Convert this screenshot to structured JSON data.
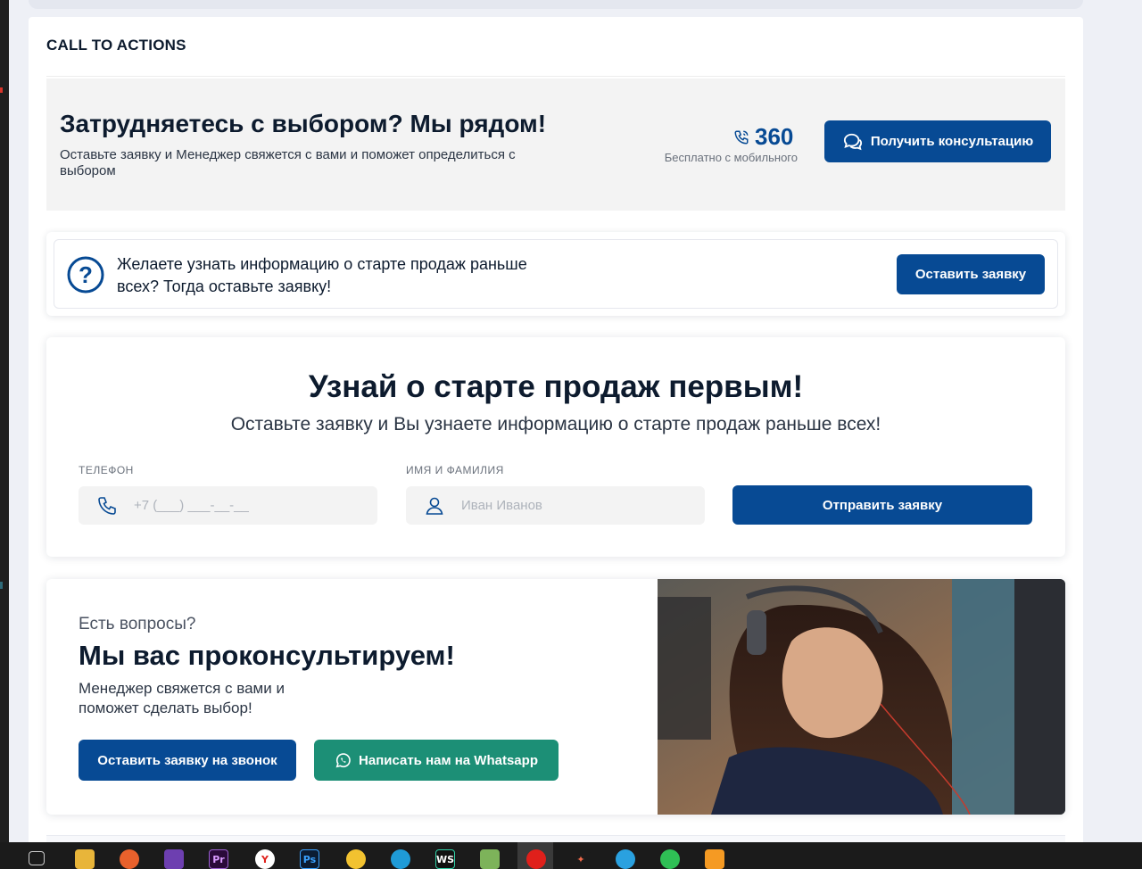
{
  "panel": {
    "title": "CALL TO ACTIONS"
  },
  "cta1": {
    "title": "Затрудняетесь с выбором? Мы рядом!",
    "text": "Оставьте заявку и Менеджер свяжется с вами и поможет определиться с выбором",
    "phone": "360",
    "phone_note": "Бесплатно с мобильного",
    "button": "Получить консультацию"
  },
  "cta2": {
    "text": "Желаете узнать информацию о старте продаж раньше всех? Тогда оставьте заявку!",
    "button": "Оставить заявку"
  },
  "cta3": {
    "title": "Узнай о старте продаж первым!",
    "subtitle": "Оставьте заявку и Вы узнаете информацию о старте продаж раньше всех!",
    "phone_label": "ТЕЛЕФОН",
    "phone_placeholder": "+7 (___) ___-__-__",
    "name_label": "ИМЯ И ФАМИЛИЯ",
    "name_placeholder": "Иван Иванов",
    "button": "Отправить заявку"
  },
  "cta4": {
    "pre": "Есть вопросы?",
    "title": "Мы вас проконсультируем!",
    "text": "Менеджер свяжется с вами и поможет сделать выбор!",
    "call_button": "Оставить заявку на звонок",
    "whatsapp_button": "Написать нам на Whatsapp"
  },
  "colors": {
    "primary": "#074a94",
    "whatsapp": "#1c8f76",
    "muted_bg": "#f3f3f3"
  },
  "taskbar": {
    "icons": [
      "windows-explorer-icon",
      "file-explorer-icon",
      "firefox-icon",
      "visual-studio-icon",
      "premiere-icon",
      "yandex-icon",
      "photoshop-icon",
      "chrome-icon",
      "edge-icon",
      "webstorm-icon",
      "app-icon",
      "opera-icon",
      "figma-icon",
      "telegram-icon",
      "whatsapp-icon",
      "media-player-icon"
    ]
  }
}
